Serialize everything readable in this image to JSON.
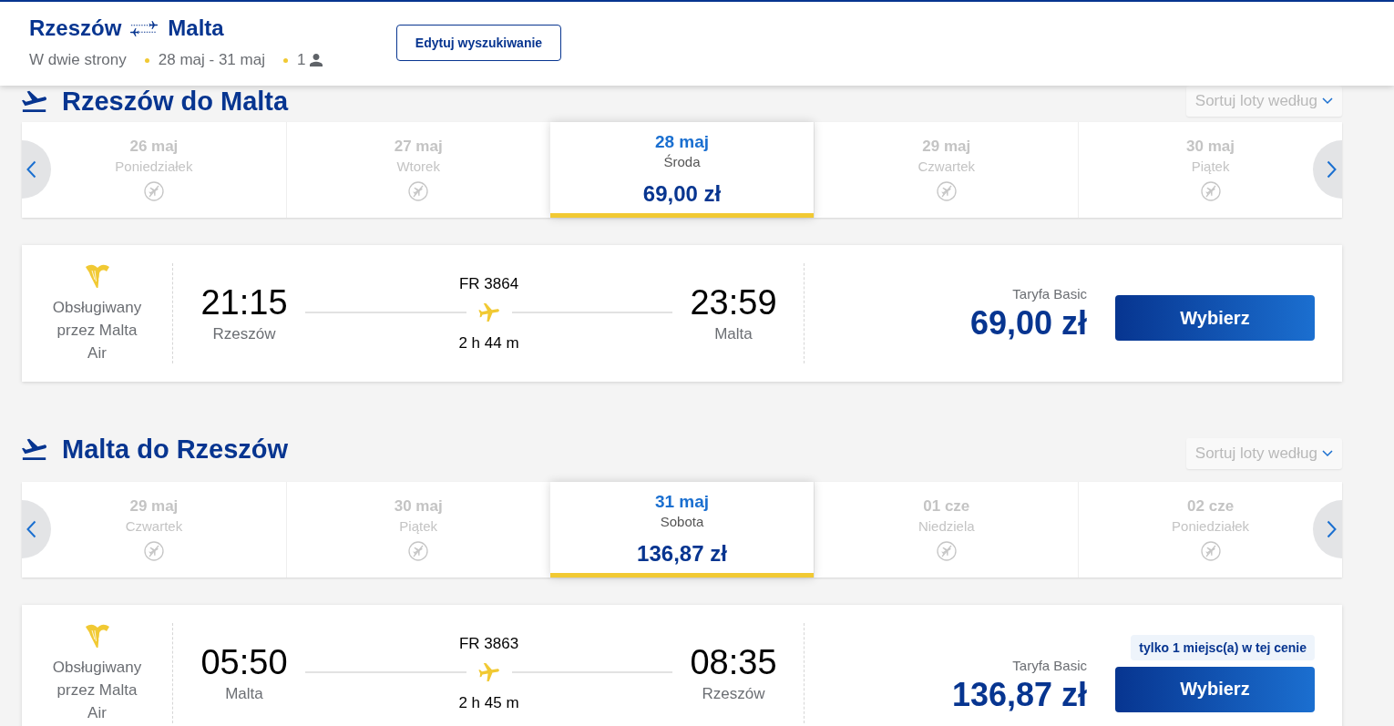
{
  "header": {
    "origin": "Rzeszów",
    "destination": "Malta",
    "trip_type": "W dwie strony",
    "dates": "28 maj - 31 maj",
    "passengers": "1",
    "edit_button": "Edytuj wyszukiwanie"
  },
  "sections": [
    {
      "title": "Rzeszów do Malta",
      "sort_label": "Sortuj loty według",
      "dates": [
        {
          "date": "26 maj",
          "day": "Poniedziałek",
          "selected": false
        },
        {
          "date": "27 maj",
          "day": "Wtorek",
          "selected": false
        },
        {
          "date": "28 maj",
          "day": "Środa",
          "price": "69,00 zł",
          "selected": true
        },
        {
          "date": "29 maj",
          "day": "Czwartek",
          "selected": false
        },
        {
          "date": "30 maj",
          "day": "Piątek",
          "selected": false
        }
      ],
      "flights": [
        {
          "operator": "Obsługiwany przez Malta Air",
          "departure_time": "21:15",
          "departure_city": "Rzeszów",
          "flight_number": "FR 3864",
          "duration": "2 h 44 m",
          "arrival_time": "23:59",
          "arrival_city": "Malta",
          "fare": "Taryfa Basic",
          "price": "69,00 zł",
          "button": "Wybierz"
        }
      ]
    },
    {
      "title": "Malta do Rzeszów",
      "sort_label": "Sortuj loty według",
      "dates": [
        {
          "date": "29 maj",
          "day": "Czwartek",
          "selected": false
        },
        {
          "date": "30 maj",
          "day": "Piątek",
          "selected": false
        },
        {
          "date": "31 maj",
          "day": "Sobota",
          "price": "136,87 zł",
          "selected": true
        },
        {
          "date": "01 cze",
          "day": "Niedziela",
          "selected": false
        },
        {
          "date": "02 cze",
          "day": "Poniedziałek",
          "selected": false
        }
      ],
      "flights": [
        {
          "operator": "Obsługiwany przez Malta Air",
          "departure_time": "05:50",
          "departure_city": "Malta",
          "flight_number": "FR 3863",
          "duration": "2 h 45 m",
          "arrival_time": "08:35",
          "arrival_city": "Rzeszów",
          "fare": "Taryfa Basic",
          "price": "136,87 zł",
          "seats_note": "tylko 1 miejsc(a) w tej cenie",
          "button": "Wybierz"
        }
      ]
    }
  ]
}
